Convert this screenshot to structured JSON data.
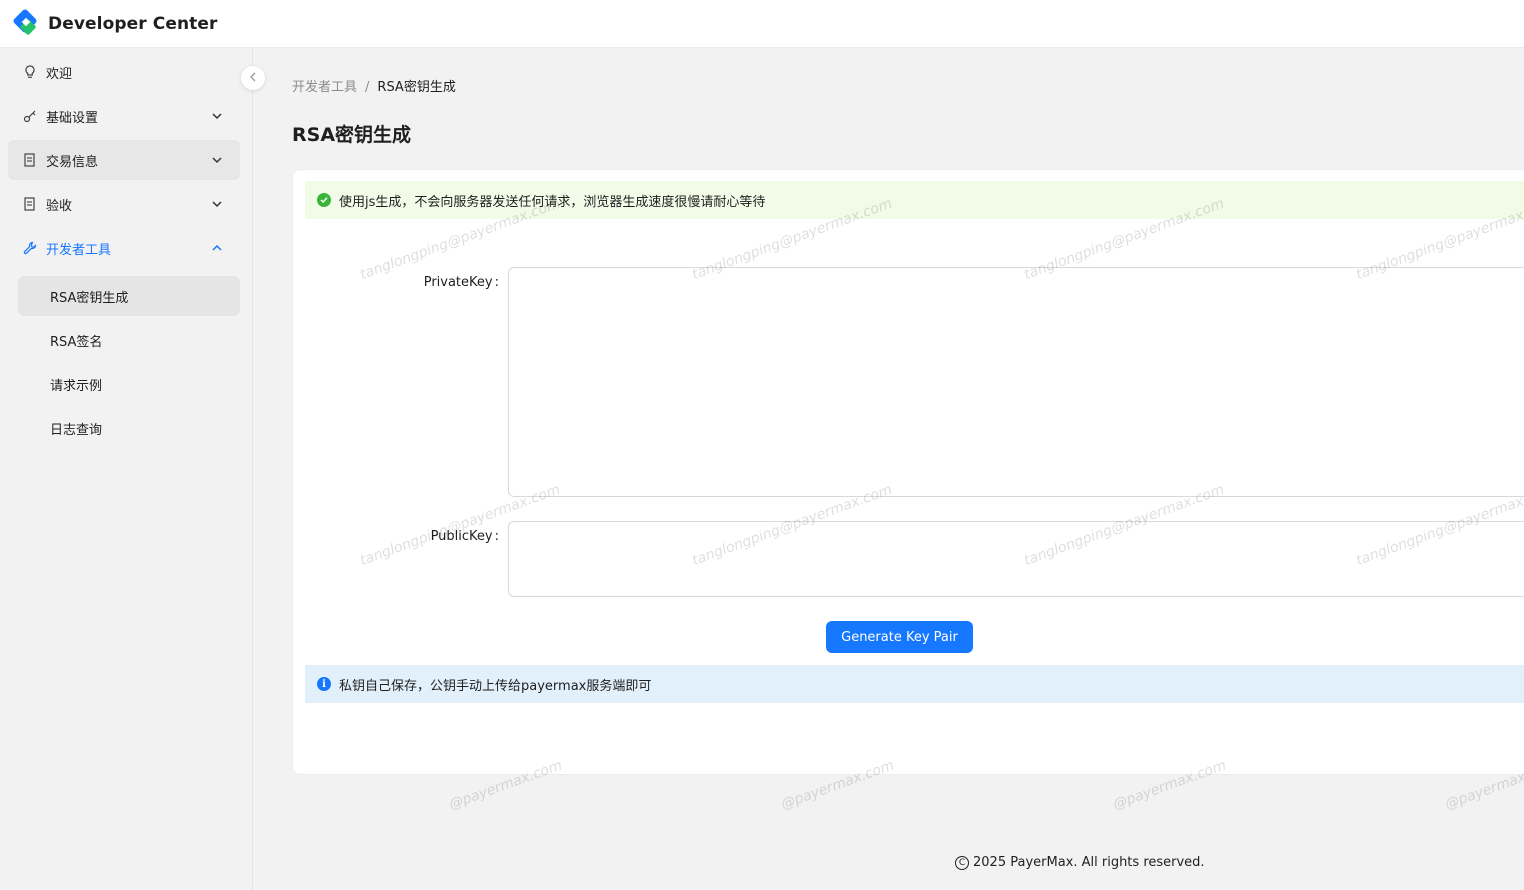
{
  "header": {
    "app_title": "Developer Center"
  },
  "sidebar": {
    "items": [
      {
        "label": "欢迎",
        "icon": "bulb-icon"
      },
      {
        "label": "基础设置",
        "icon": "key-icon"
      },
      {
        "label": "交易信息",
        "icon": "receipt-icon"
      },
      {
        "label": "验收",
        "icon": "receipt-icon"
      },
      {
        "label": "开发者工具",
        "icon": "wrench-icon"
      }
    ],
    "sub_items": [
      {
        "label": "RSA密钥生成"
      },
      {
        "label": "RSA签名"
      },
      {
        "label": "请求示例"
      },
      {
        "label": "日志查询"
      }
    ]
  },
  "breadcrumb": {
    "parent": "开发者工具",
    "separator": "/",
    "current": "RSA密钥生成"
  },
  "page": {
    "title": "RSA密钥生成"
  },
  "alerts": {
    "success": "使用js生成，不会向服务器发送任何请求，浏览器生成速度很慢请耐心等待",
    "info": "私钥自己保存，公钥手动上传给payermax服务端即可"
  },
  "form": {
    "private_key_label": "PrivateKey",
    "private_key_value": "",
    "public_key_label": "PublicKey",
    "public_key_value": "",
    "colon": ":",
    "generate_label": "Generate Key Pair"
  },
  "footer": {
    "copyright": "2025 PayerMax. All rights reserved."
  },
  "watermark": {
    "text": "tanglongping@payermax.com",
    "partial": "@payermax.com"
  },
  "colors": {
    "primary": "#1677ff",
    "success_bg": "#f1fbe8",
    "info_bg": "#e2f0fc"
  }
}
